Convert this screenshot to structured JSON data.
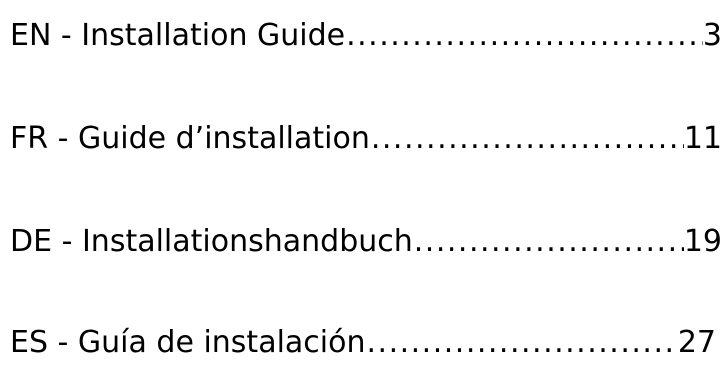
{
  "toc": {
    "entries": [
      {
        "title": "EN - Installation Guide",
        "page": "3"
      },
      {
        "title": "FR - Guide d’installation",
        "page": "11"
      },
      {
        "title": "DE - Installationshandbuch ",
        "page": "19"
      },
      {
        "title": "ES - Guía de instalación",
        "page": "27"
      }
    ]
  }
}
